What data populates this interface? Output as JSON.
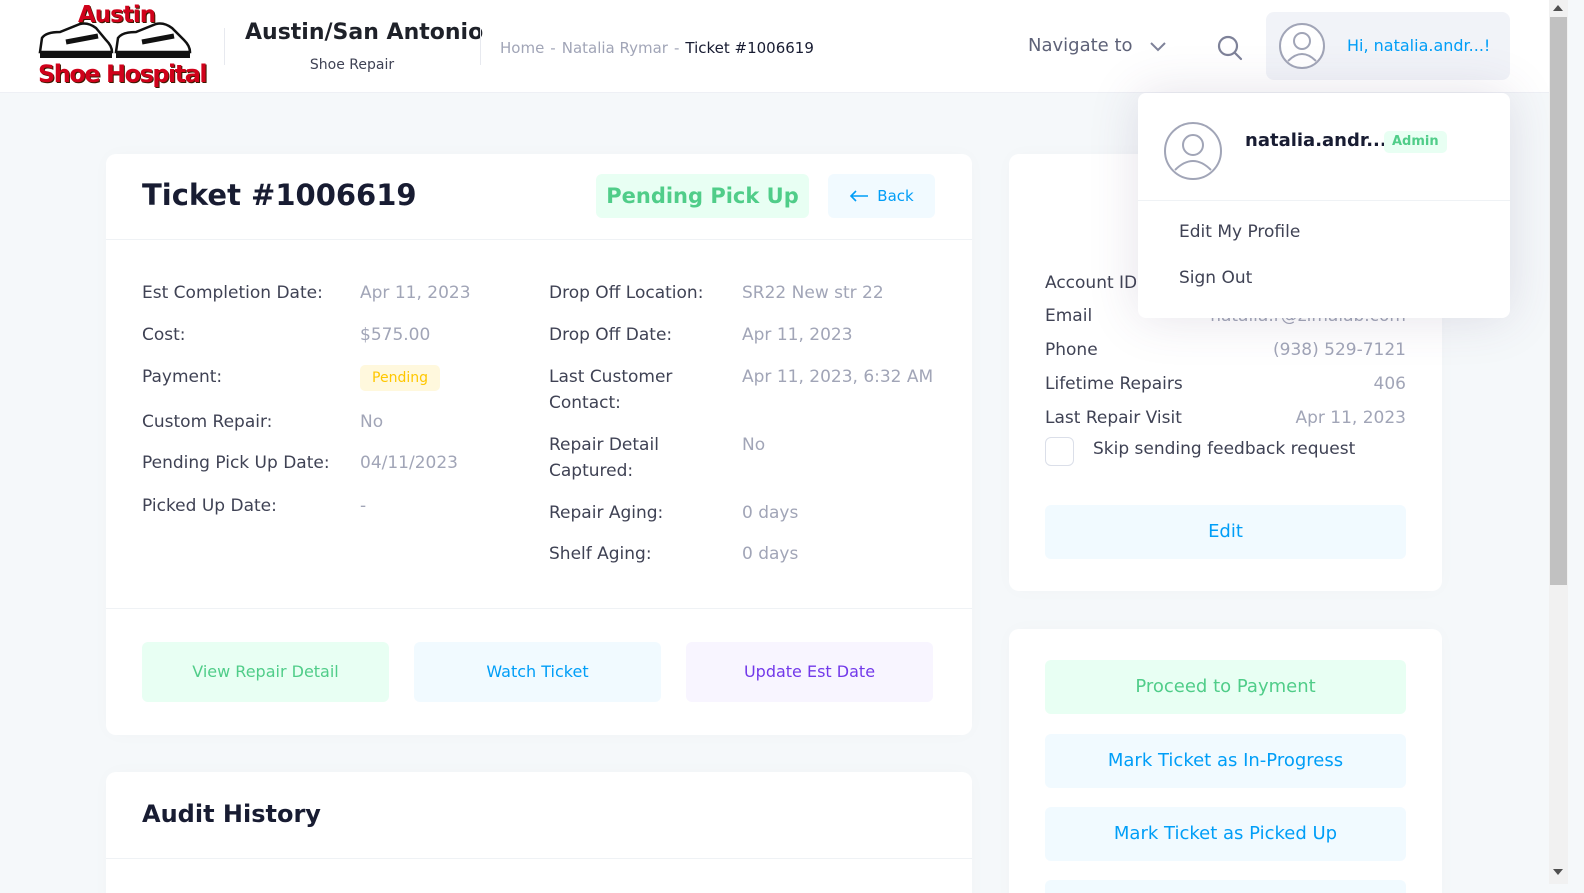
{
  "logo": {
    "line1": "Austin",
    "line2": "Shoe Hospital"
  },
  "brand": {
    "title": "Austin/San Antonio",
    "subtitle": "Shoe Repair"
  },
  "breadcrumb": {
    "home": "Home",
    "customer": "Natalia Rymar",
    "current": "Ticket #1006619",
    "separator": "-"
  },
  "header": {
    "navigate_label": "Navigate to",
    "greeting": "Hi, natalia.andr...!"
  },
  "ticket": {
    "title": "Ticket #1006619",
    "status": "Pending Pick Up",
    "back_label": "Back",
    "left_fields": [
      {
        "label": "Est Completion Date:",
        "value": "Apr 11, 2023"
      },
      {
        "label": "Cost:",
        "value": "$575.00"
      },
      {
        "label": "Payment:",
        "value": "Pending"
      },
      {
        "label": "Custom Repair:",
        "value": "No"
      },
      {
        "label": "Pending Pick Up Date:",
        "value": "04/11/2023"
      },
      {
        "label": "Picked Up Date:",
        "value": "-"
      }
    ],
    "right_fields": [
      {
        "label": "Drop Off Location:",
        "value": "SR22 New str 22"
      },
      {
        "label": "Drop Off Date:",
        "value": "Apr 11, 2023"
      },
      {
        "label_line1": "Last Customer",
        "label_line2": "Contact:",
        "value": "Apr 11, 2023, 6:32 AM"
      },
      {
        "label_line1": "Repair Detail",
        "label_line2": "Captured:",
        "value": "No"
      },
      {
        "label": "Repair Aging:",
        "value": "0 days"
      },
      {
        "label": "Shelf Aging:",
        "value": "0 days"
      }
    ],
    "buttons": {
      "view_repair": "View Repair Detail",
      "watch": "Watch Ticket",
      "update_date": "Update Est Date"
    }
  },
  "audit": {
    "title": "Audit History"
  },
  "customer": {
    "rows": [
      {
        "label": "Account ID",
        "value": ""
      },
      {
        "label": "Email",
        "value": "natalia.r@zimalab.com"
      },
      {
        "label": "Phone",
        "value": "(938) 529-7121"
      },
      {
        "label": "Lifetime Repairs",
        "value": "406"
      },
      {
        "label": "Last Repair Visit",
        "value": "Apr 11, 2023"
      }
    ],
    "skip_feedback_label": "Skip sending feedback request",
    "skip_feedback_checked": false,
    "edit_label": "Edit"
  },
  "actions": {
    "proceed_payment": "Proceed to Payment",
    "mark_in_progress": "Mark Ticket as In-Progress",
    "mark_picked_up": "Mark Ticket as Picked Up"
  },
  "user_menu": {
    "username": "natalia.andr...",
    "role": "Admin",
    "edit_profile": "Edit My Profile",
    "sign_out": "Sign Out"
  },
  "colors": {
    "primary": "#009ef7",
    "success": "#50cd89",
    "warning": "#ffc700",
    "purple": "#7239ea",
    "page_bg": "#f5f8fa"
  }
}
